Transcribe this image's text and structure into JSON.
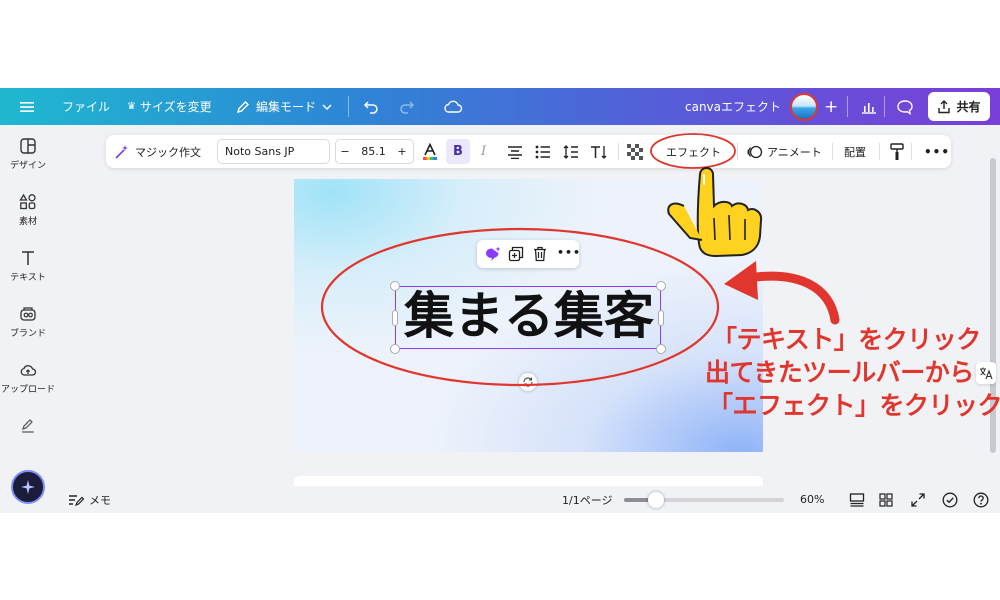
{
  "topbar": {
    "menu_icon": "hamburger-icon",
    "file": "ファイル",
    "resize": "サイズを変更",
    "edit_mode": "編集モード",
    "design_title": "canvaエフェクト",
    "share": "共有"
  },
  "sidebar": {
    "items": [
      {
        "label": "デザイン",
        "icon": "layout-icon"
      },
      {
        "label": "素材",
        "icon": "shapes-icon"
      },
      {
        "label": "テキスト",
        "icon": "text-icon"
      },
      {
        "label": "ブランド",
        "icon": "brand-icon"
      },
      {
        "label": "アップロード",
        "icon": "cloud-upload-icon"
      },
      {
        "label": "",
        "icon": "draw-icon"
      }
    ]
  },
  "toolbar": {
    "magic_write": "マジック作文",
    "font": "Noto Sans JP",
    "font_size": "85.1",
    "minus": "−",
    "plus": "+",
    "effects": "エフェクト",
    "animate": "アニメート",
    "position": "配置",
    "more": "•••"
  },
  "canvas": {
    "text": "集まる集客",
    "more": "•••"
  },
  "bottombar": {
    "notes": "メモ",
    "pages": "1/1ページ",
    "zoom_percent": "60%",
    "zoom_fraction": 0.2
  },
  "annotations": {
    "line1": "「テキスト」をクリック",
    "line2": "出てきたツールバーから",
    "line3": "「エフェクト」をクリック"
  },
  "colors": {
    "annotation_red": "#e0362d",
    "selection_purple": "#8b3dff",
    "pointer_yellow": "#ffd21f"
  }
}
